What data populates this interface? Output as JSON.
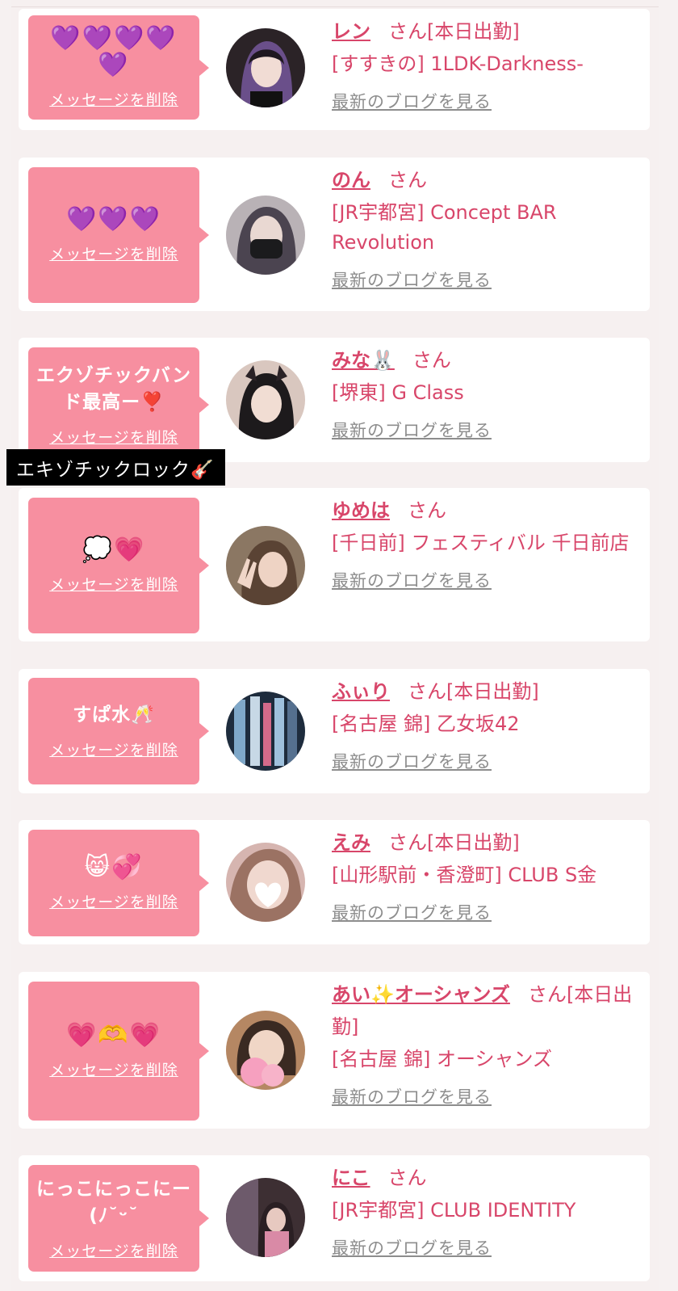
{
  "delete_label": "メッセージを削除",
  "blog_label": "最新のブログを見る",
  "san_label": "さん",
  "tooltip": "エキゾチックロック🎸",
  "entries": [
    {
      "message": "💜💜💜💜💜",
      "name": "レン",
      "status": "[本日出勤]",
      "shop": "[すすきの] 1LDK-Darkness-"
    },
    {
      "message": "💜💜💜",
      "name": "のん",
      "status": "",
      "shop": "[JR宇都宮] Concept BAR Revolution"
    },
    {
      "message": "エクゾチックバンド最高ー❣️",
      "name": "みな🐰",
      "status": "",
      "shop": "[堺東] G Class"
    },
    {
      "message": "💭💗",
      "name": "ゆめは",
      "status": "",
      "shop": "[千日前] フェスティバル 千日前店"
    },
    {
      "message": "すぱ水🥂",
      "name": "ふぃり",
      "status": "[本日出勤]",
      "shop": "[名古屋 錦] 乙女坂42"
    },
    {
      "message": "😸💞",
      "name": "えみ",
      "status": "[本日出勤]",
      "shop": "[山形駅前・香澄町] CLUB S金"
    },
    {
      "message": "💗🫶💗",
      "name": "あい✨オーシャンズ",
      "status": "[本日出勤]",
      "shop": "[名古屋 錦] オーシャンズ"
    },
    {
      "message": "にっこにっこにー (ﾉ˘ᵕ˘",
      "name": "にこ",
      "status": "",
      "shop": "[JR宇都宮] CLUB IDENTITY"
    }
  ],
  "colors": {
    "accent": "#d8466a",
    "bubble": "#f78fa0",
    "link_gray": "#8d8d8d"
  }
}
